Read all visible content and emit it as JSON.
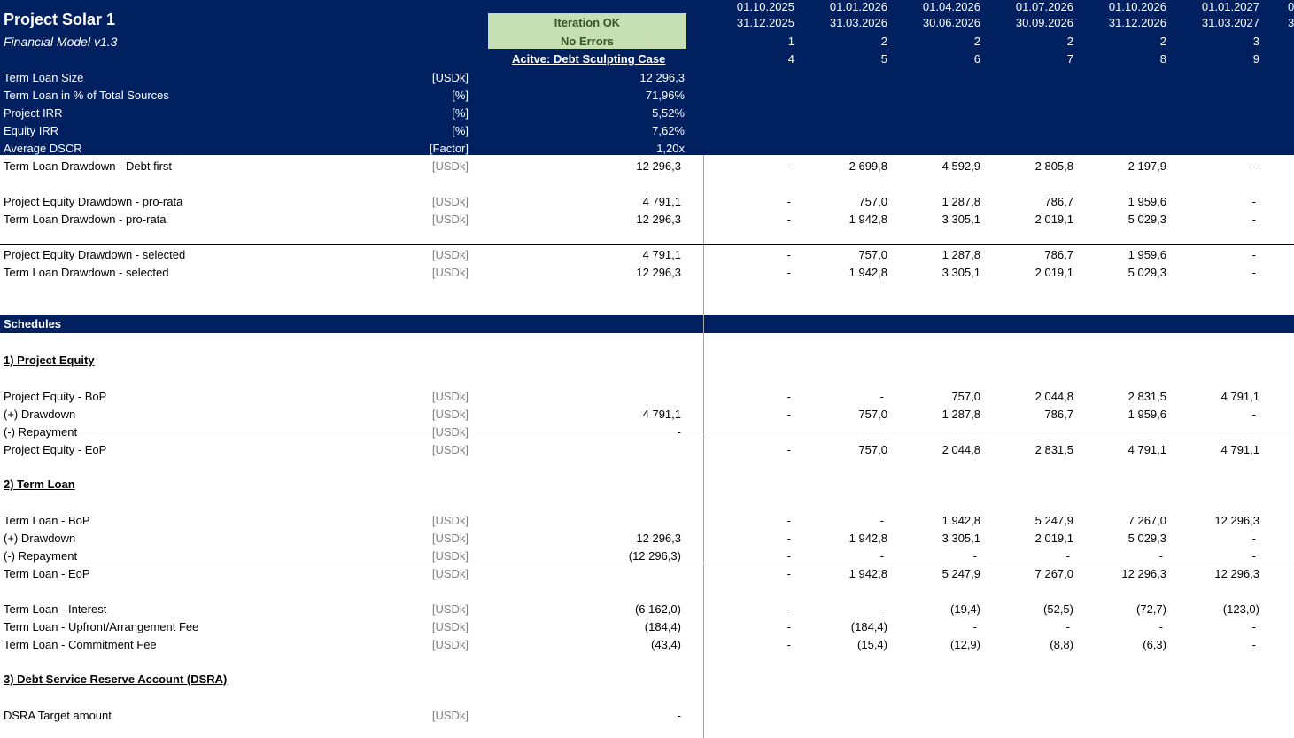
{
  "header": {
    "title": "Project Solar 1",
    "subtitle": "Financial Model v1.3",
    "status_line1": "Iteration OK",
    "status_line2": "No Errors",
    "active_case": "Acitve: Debt Sculpting Case"
  },
  "periods": [
    {
      "start": "01.10.2025",
      "end": "31.12.2025",
      "year_idx": "1",
      "period_idx": "4"
    },
    {
      "start": "01.01.2026",
      "end": "31.03.2026",
      "year_idx": "2",
      "period_idx": "5"
    },
    {
      "start": "01.04.2026",
      "end": "30.06.2026",
      "year_idx": "2",
      "period_idx": "6"
    },
    {
      "start": "01.07.2026",
      "end": "30.09.2026",
      "year_idx": "2",
      "period_idx": "7"
    },
    {
      "start": "01.10.2026",
      "end": "31.12.2026",
      "year_idx": "2",
      "period_idx": "8"
    },
    {
      "start": "01.01.2027",
      "end": "31.03.2027",
      "year_idx": "3",
      "period_idx": "9"
    }
  ],
  "partial_col": {
    "start": "0",
    "end": "3"
  },
  "kpis": [
    {
      "label": "Term Loan Size",
      "unit": "[USDk]",
      "value": "12 296,3"
    },
    {
      "label": "Term Loan in % of Total Sources",
      "unit": "[%]",
      "value": "71,96%"
    },
    {
      "label": "Project IRR",
      "unit": "[%]",
      "value": "5,52%"
    },
    {
      "label": "Equity IRR",
      "unit": "[%]",
      "value": "7,62%"
    },
    {
      "label": "Average DSCR",
      "unit": "[Factor]",
      "value": "1,20x"
    }
  ],
  "drawdown_rows": [
    {
      "label": "Term Loan Drawdown - Debt first",
      "unit": "[USDk]",
      "total": "12 296,3",
      "values": [
        "-",
        "2 699,8",
        "4 592,9",
        "2 805,8",
        "2 197,9",
        "-"
      ]
    },
    {
      "label": "Project Equity Drawdown - pro-rata",
      "unit": "[USDk]",
      "total": "4 791,1",
      "values": [
        "-",
        "757,0",
        "1 287,8",
        "786,7",
        "1 959,6",
        "-"
      ]
    },
    {
      "label": "Term Loan Drawdown - pro-rata",
      "unit": "[USDk]",
      "total": "12 296,3",
      "values": [
        "-",
        "1 942,8",
        "3 305,1",
        "2 019,1",
        "5 029,3",
        "-"
      ]
    },
    {
      "label": "Project Equity Drawdown - selected",
      "unit": "[USDk]",
      "total": "4 791,1",
      "values": [
        "-",
        "757,0",
        "1 287,8",
        "786,7",
        "1 959,6",
        "-"
      ]
    },
    {
      "label": "Term Loan Drawdown - selected",
      "unit": "[USDk]",
      "total": "12 296,3",
      "values": [
        "-",
        "1 942,8",
        "3 305,1",
        "2 019,1",
        "5 029,3",
        "-"
      ]
    }
  ],
  "schedules_label": "Schedules",
  "equity": {
    "heading": "1) Project Equity",
    "rows": [
      {
        "label": "Project Equity - BoP",
        "unit": "[USDk]",
        "total": "",
        "values": [
          "-",
          "-",
          "757,0",
          "2 044,8",
          "2 831,5",
          "4 791,1"
        ]
      },
      {
        "label": "(+) Drawdown",
        "unit": "[USDk]",
        "total": "4 791,1",
        "values": [
          "-",
          "757,0",
          "1 287,8",
          "786,7",
          "1 959,6",
          "-"
        ]
      },
      {
        "label": "(-) Repayment",
        "unit": "[USDk]",
        "total": "-",
        "values": [
          "",
          "",
          "",
          "",
          "",
          ""
        ]
      },
      {
        "label": "Project Equity - EoP",
        "unit": "[USDk]",
        "total": "",
        "values": [
          "-",
          "757,0",
          "2 044,8",
          "2 831,5",
          "4 791,1",
          "4 791,1"
        ]
      }
    ]
  },
  "loan": {
    "heading": "2) Term Loan",
    "rows": [
      {
        "label": "Term Loan - BoP",
        "unit": "[USDk]",
        "total": "",
        "values": [
          "-",
          "-",
          "1 942,8",
          "5 247,9",
          "7 267,0",
          "12 296,3"
        ]
      },
      {
        "label": "(+) Drawdown",
        "unit": "[USDk]",
        "total": "12 296,3",
        "values": [
          "-",
          "1 942,8",
          "3 305,1",
          "2 019,1",
          "5 029,3",
          "-"
        ]
      },
      {
        "label": "(-) Repayment",
        "unit": "[USDk]",
        "total": "(12 296,3)",
        "values": [
          "-",
          "-",
          "-",
          "-",
          "-",
          "-"
        ]
      },
      {
        "label": "Term Loan - EoP",
        "unit": "[USDk]",
        "total": "",
        "values": [
          "-",
          "1 942,8",
          "5 247,9",
          "7 267,0",
          "12 296,3",
          "12 296,3"
        ]
      },
      {
        "label": "Term Loan - Interest",
        "unit": "[USDk]",
        "total": "(6 162,0)",
        "values": [
          "-",
          "-",
          "(19,4)",
          "(52,5)",
          "(72,7)",
          "(123,0)"
        ]
      },
      {
        "label": "Term Loan - Upfront/Arrangement Fee",
        "unit": "[USDk]",
        "total": "(184,4)",
        "values": [
          "-",
          "(184,4)",
          "-",
          "-",
          "-",
          "-"
        ]
      },
      {
        "label": "Term Loan - Commitment Fee",
        "unit": "[USDk]",
        "total": "(43,4)",
        "values": [
          "-",
          "(15,4)",
          "(12,9)",
          "(8,8)",
          "(6,3)",
          "-"
        ]
      }
    ]
  },
  "dsra": {
    "heading": "3) Debt Service Reserve Account (DSRA)",
    "rows": [
      {
        "label": "DSRA Target amount",
        "unit": "[USDk]",
        "total": "-",
        "values": [
          "",
          "",
          "",
          "",
          "",
          ""
        ]
      }
    ]
  },
  "colors": {
    "navy": "#002060",
    "status_bg": "#c6e0b4",
    "status_text": "#375623",
    "unit_grey": "#808080"
  }
}
